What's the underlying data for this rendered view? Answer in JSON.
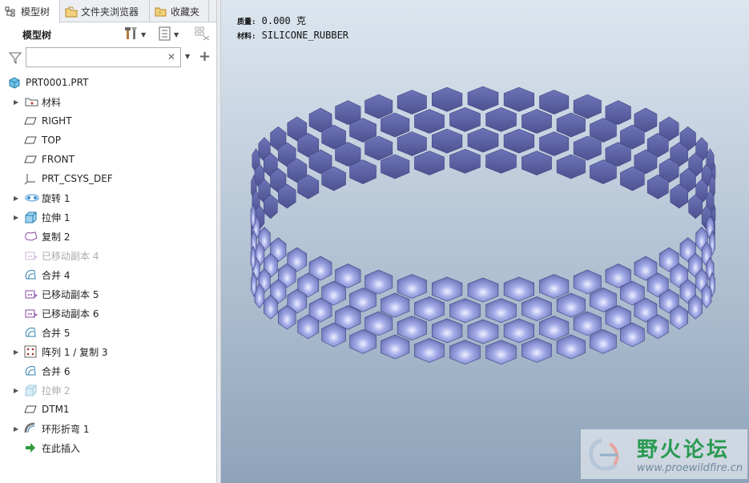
{
  "tabs": [
    {
      "label": "模型树",
      "icon": "model-tree-icon"
    },
    {
      "label": "文件夹浏览器",
      "icon": "folder-browser-icon"
    },
    {
      "label": "收藏夹",
      "icon": "favorites-icon"
    }
  ],
  "tree_header": {
    "title": "模型树"
  },
  "search": {
    "value": "",
    "placeholder": ""
  },
  "tree": {
    "root": {
      "label": "PRT0001.PRT",
      "icon": "part-icon"
    },
    "items": [
      {
        "label": "材料",
        "icon": "material-icon",
        "expandable": true,
        "dimmed": false
      },
      {
        "label": "RIGHT",
        "icon": "datum-plane-icon",
        "expandable": false,
        "dimmed": false
      },
      {
        "label": "TOP",
        "icon": "datum-plane-icon",
        "expandable": false,
        "dimmed": false
      },
      {
        "label": "FRONT",
        "icon": "datum-plane-icon",
        "expandable": false,
        "dimmed": false
      },
      {
        "label": "PRT_CSYS_DEF",
        "icon": "csys-icon",
        "expandable": false,
        "dimmed": false
      },
      {
        "label": "旋转 1",
        "icon": "revolve-icon",
        "expandable": true,
        "dimmed": false
      },
      {
        "label": "拉伸 1",
        "icon": "extrude-icon",
        "expandable": true,
        "dimmed": false
      },
      {
        "label": "复制 2",
        "icon": "copy-icon",
        "expandable": false,
        "dimmed": false
      },
      {
        "label": "已移动副本 4",
        "icon": "moved-copy-icon",
        "expandable": false,
        "dimmed": true
      },
      {
        "label": "合并 4",
        "icon": "merge-icon",
        "expandable": false,
        "dimmed": false
      },
      {
        "label": "已移动副本 5",
        "icon": "moved-copy-icon",
        "expandable": false,
        "dimmed": false
      },
      {
        "label": "已移动副本 6",
        "icon": "moved-copy-icon",
        "expandable": false,
        "dimmed": false
      },
      {
        "label": "合并 5",
        "icon": "merge-icon",
        "expandable": false,
        "dimmed": false
      },
      {
        "label": "阵列 1 / 复制 3",
        "icon": "pattern-icon",
        "expandable": true,
        "dimmed": false
      },
      {
        "label": "合并 6",
        "icon": "merge-icon",
        "expandable": false,
        "dimmed": false
      },
      {
        "label": "拉伸 2",
        "icon": "extrude-icon",
        "expandable": true,
        "dimmed": true
      },
      {
        "label": "DTM1",
        "icon": "datum-plane-icon",
        "expandable": false,
        "dimmed": false
      },
      {
        "label": "环形折弯 1",
        "icon": "toroidal-bend-icon",
        "expandable": true,
        "dimmed": false
      },
      {
        "label": "在此插入",
        "icon": "insert-here-icon",
        "expandable": false,
        "dimmed": false
      }
    ]
  },
  "viewport": {
    "mass_label": "质量:",
    "mass_value": "0.000 克",
    "material_label": "材料:",
    "material_value": "SILICONE_RUBBER"
  },
  "watermark": {
    "title": "野火论坛",
    "url": "www.proewildfire.cn"
  },
  "colors": {
    "model": "#8f98de",
    "accent": "#2a9a52"
  }
}
